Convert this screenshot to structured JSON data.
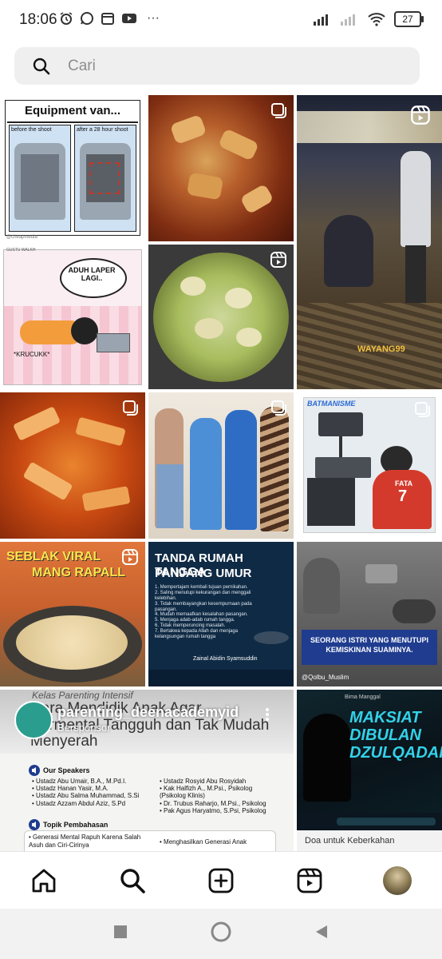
{
  "status_bar": {
    "time": "18:06",
    "battery": "27",
    "more": "···"
  },
  "search": {
    "placeholder": "Cari"
  },
  "posts": [
    {
      "title": "Equipment van...",
      "before": "before the shoot",
      "after": "after a 28 hour shoot",
      "credit": "@cheapmedia"
    },
    {
      "label": "food-photo-sauce"
    },
    {
      "label": "night-market-video",
      "watermark": "WAYANG99"
    },
    {
      "speech": "ADUH LAPER LAGI..",
      "sound": "*KRUCUKK*",
      "credit": "GUSTU WALKH"
    },
    {
      "label": "green-dumplings-reel"
    },
    {
      "label": "red-snack-photo"
    },
    {
      "label": "clinic-group-photo"
    },
    {
      "tag": "BATMANISME",
      "jersey_name": "FATA",
      "jersey_number": "7"
    },
    {
      "title_line1": "SEBLAK VIRAL",
      "title_line2": "MANG RAPALL"
    },
    {
      "title_line1": "TANDA RUMAH TANGGA",
      "title_line2": "PANJANG UMUR",
      "items": [
        "1. Mempertajam kembali tujuan pernikahan.",
        "2. Saling menutupi kekurangan dan menggali kelebihan.",
        "3. Tidak membayangkan kesempurnaan pada pasangan.",
        "4. Mudah memaafkan kesalahan pasangan.",
        "5. Menjaga adab-adab rumah tangga.",
        "6. Tidak memperuncing masalah.",
        "7. Bertakwa kepada Allah dan menjaga kelangsungan rumah tangga"
      ],
      "author": "Zainal Abidin Syamsuddin"
    },
    {
      "caption": "SEORANG ISTRI YANG MENUTUPI KEMISKINAN SUAMINYA.",
      "credit": "@Qolbu_Muslim"
    },
    {
      "handle": "parenting_deenacademyid",
      "sponsored": "Bersponsor",
      "script_title": "Kelas Parenting Intensif",
      "headline": "Cara Mendidik Anak Agar Bermental Tangguh dan Tak Mudah Menyerah",
      "speakers_label": "Our Speakers",
      "speakers_left": [
        "• Ustadz Abu Umair, B.A., M.Pd.I.",
        "• Ustadz Hanan Yasir, M.A.",
        "• Ustadz Abu Salma Muhammad, S.Si",
        "• Ustadz Azzam Abdul Aziz, S.Pd"
      ],
      "speakers_right": [
        "• Ustadz Rosyid Abu Rosyidah",
        "• Kak Halfizh A., M.Psi., Psikolog",
        "  (Psikolog Klinis)",
        "• Dr. Trubus Raharjo, M.Psi., Psikolog",
        "• Pak Agus Haryatmo, S.Psi, Psikolog"
      ],
      "topics_label": "Topik Pembahasan",
      "topic_left": "• Generasi Mental Rapuh Karena Salah Asuh dan Ciri-Cirinya",
      "topic_right": "• Menghasilkan Generasi Anak"
    },
    {
      "title": "MAKSIAT DIBULAN DZULQADAH",
      "brand": "Bima Manggal",
      "footer": "Doa untuk Keberkahan"
    }
  ],
  "bottom_nav": [
    {
      "name": "home-icon"
    },
    {
      "name": "search-icon"
    },
    {
      "name": "create-icon"
    },
    {
      "name": "reels-icon"
    },
    {
      "name": "profile-avatar"
    }
  ],
  "colors": {
    "accent": "#0f2a5c",
    "search_bg": "#efefef"
  }
}
